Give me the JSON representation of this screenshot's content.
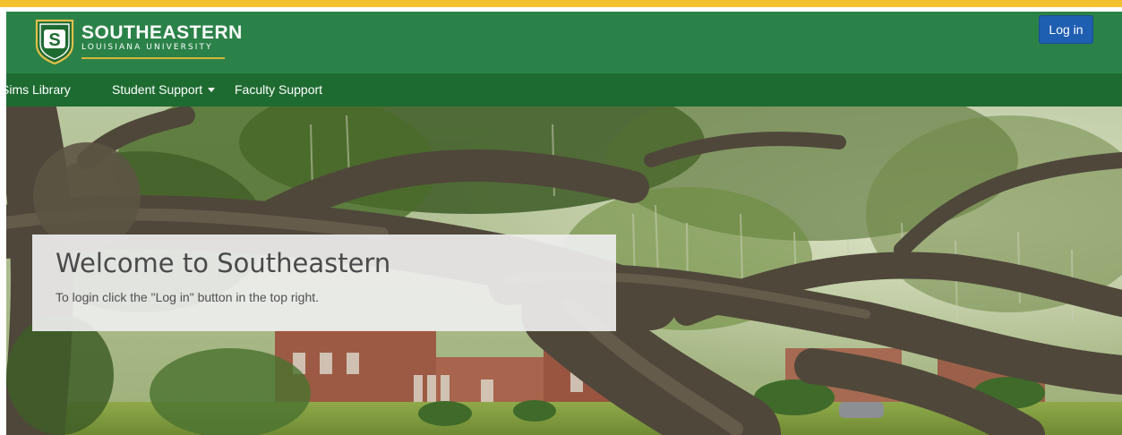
{
  "header": {
    "logo": {
      "monogram": "S",
      "wordmark_top": "SOUTHEASTERN",
      "wordmark_bottom": "LOUISIANA UNIVERSITY"
    },
    "login_label": "Log in"
  },
  "nav": {
    "items": [
      {
        "label": "Sims Library",
        "has_dropdown": false
      },
      {
        "label": "Student Support",
        "has_dropdown": true
      },
      {
        "label": "Faculty Support",
        "has_dropdown": false
      }
    ]
  },
  "hero": {
    "title": "Welcome to Southeastern",
    "subtitle": "To login click the \"Log in\" button in the top right."
  },
  "colors": {
    "gold_accent": "#f2c12e",
    "header_green": "#2b8248",
    "nav_green": "#1e6b31",
    "login_blue": "#1f5fb2"
  }
}
